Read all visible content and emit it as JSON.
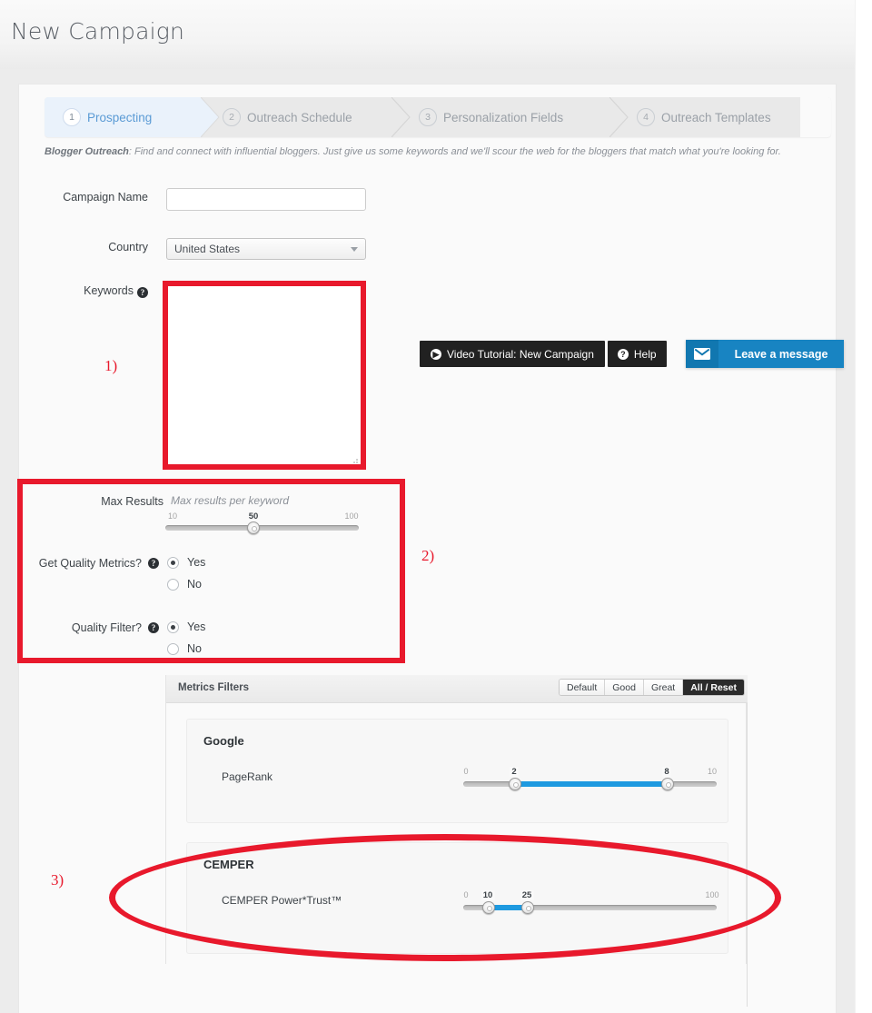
{
  "header": {
    "title": "New Campaign"
  },
  "wizard": {
    "steps": [
      {
        "num": "1",
        "label": "Prospecting",
        "active": true
      },
      {
        "num": "2",
        "label": "Outreach Schedule",
        "active": false
      },
      {
        "num": "3",
        "label": "Personalization Fields",
        "active": false
      },
      {
        "num": "4",
        "label": "Outreach Templates",
        "active": false
      }
    ]
  },
  "subtitle": {
    "lead": "Blogger Outreach",
    "text": ": Find and connect with influential bloggers. Just give us some keywords and we'll scour the web for the bloggers that match what you're looking for."
  },
  "form": {
    "campaign_name": {
      "label": "Campaign Name",
      "value": "",
      "placeholder": ""
    },
    "country": {
      "label": "Country",
      "value": "United States"
    },
    "keywords": {
      "label": "Keywords",
      "value": "",
      "help_icon": "question-icon"
    },
    "max_results": {
      "label": "Max Results",
      "hint": "Max results per keyword",
      "min_tick": "10",
      "max_tick": "100",
      "value": "50"
    },
    "get_quality_metrics": {
      "label": "Get Quality Metrics?",
      "options": [
        "Yes",
        "No"
      ],
      "selected": "Yes"
    },
    "quality_filter": {
      "label": "Quality Filter?",
      "options": [
        "Yes",
        "No"
      ],
      "selected": "Yes"
    }
  },
  "metrics_filters": {
    "title": "Metrics Filters",
    "presets": [
      {
        "label": "Default",
        "active": false
      },
      {
        "label": "Good",
        "active": false
      },
      {
        "label": "Great",
        "active": false
      },
      {
        "label": "All / Reset",
        "active": true
      }
    ],
    "groups": [
      {
        "name": "Google",
        "metrics": [
          {
            "name": "PageRank",
            "min_tick": "0",
            "max_tick": "10",
            "low_value": "2",
            "high_value": "8",
            "range_min": 0,
            "range_max": 10
          }
        ]
      },
      {
        "name": "CEMPER",
        "metrics": [
          {
            "name": "CEMPER Power*Trust™",
            "min_tick": "0",
            "max_tick": "100",
            "low_value": "10",
            "high_value": "25",
            "range_min": 0,
            "range_max": 100
          }
        ]
      }
    ]
  },
  "widgets": {
    "video_tutorial": {
      "label": "Video Tutorial: New Campaign",
      "icon": "play-circle-icon"
    },
    "help": {
      "label": "Help",
      "icon": "question-circle-icon"
    },
    "chat": {
      "label": "Leave a message",
      "icon": "envelope-icon",
      "color": "#1884c2"
    }
  },
  "annotations": [
    {
      "id": "1",
      "label": "1)"
    },
    {
      "id": "2",
      "label": "2)"
    },
    {
      "id": "3",
      "label": "3)"
    }
  ],
  "colors": {
    "annotation_red": "#e8192c",
    "accent_blue": "#1e9ae0",
    "active_step_text": "#5b9bd5",
    "dark_button": "#212121"
  }
}
